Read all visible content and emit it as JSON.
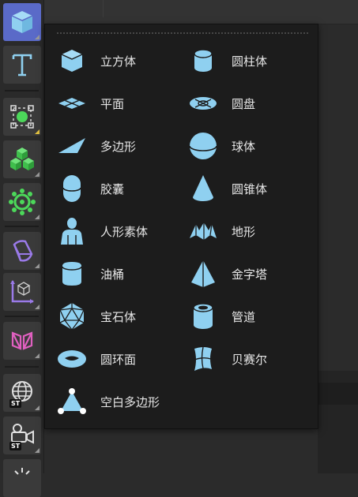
{
  "colors": {
    "icon": "#8fd0f0",
    "active_tool": "#5a6ac8",
    "menu_bg": "#1c1c1c",
    "label": "#e6e6e6",
    "st_badge": "#111111"
  },
  "toolbar": {
    "tools": [
      {
        "icon": "cube-icon"
      },
      {
        "icon": "text-icon"
      },
      {
        "icon": "selection-spline-icon"
      },
      {
        "icon": "cloner-cubes-icon"
      },
      {
        "icon": "gear-generator-icon"
      },
      {
        "icon": "deformer-icon"
      },
      {
        "icon": "axis-icon"
      },
      {
        "icon": "symmetry-icon"
      },
      {
        "icon": "globe-icon",
        "badge": "ST"
      },
      {
        "icon": "camera-icon",
        "badge": "ST"
      },
      {
        "icon": "light-icon"
      }
    ]
  },
  "menu": {
    "items": [
      {
        "label": "立方体",
        "icon": "cube-icon"
      },
      {
        "label": "圆柱体",
        "icon": "cylinder-icon"
      },
      {
        "label": "平面",
        "icon": "plane-icon"
      },
      {
        "label": "圆盘",
        "icon": "disc-icon"
      },
      {
        "label": "多边形",
        "icon": "polygon-icon"
      },
      {
        "label": "球体",
        "icon": "sphere-icon"
      },
      {
        "label": "胶囊",
        "icon": "capsule-icon"
      },
      {
        "label": "圆锥体",
        "icon": "cone-icon"
      },
      {
        "label": "人形素体",
        "icon": "figure-icon"
      },
      {
        "label": "地形",
        "icon": "landscape-icon"
      },
      {
        "label": "油桶",
        "icon": "oil-tank-icon"
      },
      {
        "label": "金字塔",
        "icon": "pyramid-icon"
      },
      {
        "label": "宝石体",
        "icon": "platonic-icon"
      },
      {
        "label": "管道",
        "icon": "tube-icon"
      },
      {
        "label": "圆环面",
        "icon": "torus-icon"
      },
      {
        "label": "贝赛尔",
        "icon": "bezier-icon"
      },
      {
        "label": "空白多边形",
        "icon": "empty-polygon-icon"
      }
    ]
  }
}
